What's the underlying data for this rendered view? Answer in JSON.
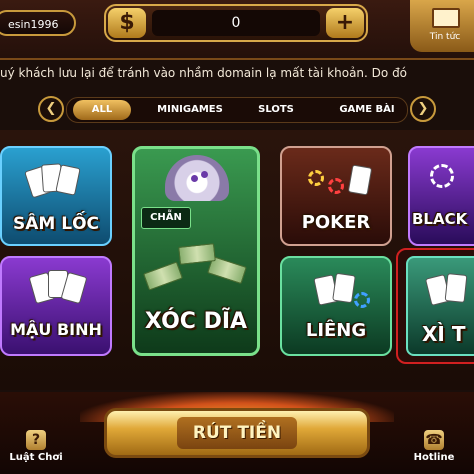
{
  "header": {
    "username": "esin1996",
    "balance": "0",
    "inbox_label": "Tin tức"
  },
  "notice": "uý khách lưu lại để tránh vào nhầm domain lạ mất tài khoản. Do đó",
  "tabs": [
    {
      "label": "ALL",
      "active": true
    },
    {
      "label": "MINIGAMES",
      "active": false
    },
    {
      "label": "SLOTS",
      "active": false
    },
    {
      "label": "GAME BÀI",
      "active": false
    }
  ],
  "games": {
    "sam_loc": "SÂM LỐC",
    "xoc_dia": "XÓC DĨA",
    "xoc_dia_tag": "CHẴN",
    "poker": "POKER",
    "black": "BLACK",
    "mau_binh": "MẬU BINH",
    "lieng": "LIÊNG",
    "xi_to": "XÌ T"
  },
  "bottom": {
    "withdraw": "RÚT TIỀN",
    "rules": "Luật Chơi",
    "hotline": "Hotline"
  },
  "colors": {
    "gold": "#d8a94a",
    "selected_border": "#d02020"
  }
}
